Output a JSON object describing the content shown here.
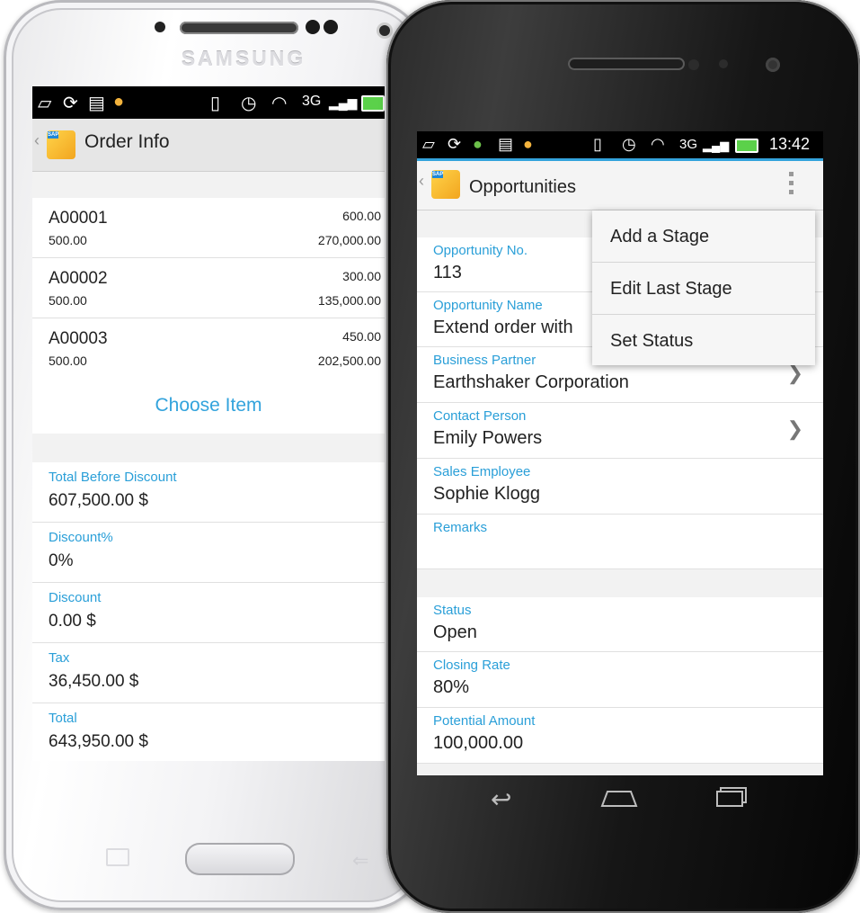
{
  "left_phone": {
    "brand": "SAMSUNG",
    "status_bar": {
      "icons": [
        "image-icon",
        "sync-icon",
        "keyboard-icon",
        "burger-icon",
        "vibrate-icon",
        "alarm-icon",
        "wifi-icon",
        "3g-icon",
        "signal-icon",
        "battery-icon"
      ]
    },
    "action_bar": {
      "back": "‹",
      "title": "Order Info"
    },
    "items": [
      {
        "code": "A00001",
        "qty": "500.00",
        "price": "600.00",
        "total": "270,000.00"
      },
      {
        "code": "A00002",
        "qty": "500.00",
        "price": "300.00",
        "total": "135,000.00"
      },
      {
        "code": "A00003",
        "qty": "500.00",
        "price": "450.00",
        "total": "202,500.00"
      }
    ],
    "choose_item": "Choose Item",
    "fields": [
      {
        "label": "Total Before Discount",
        "value": "607,500.00 $"
      },
      {
        "label": "Discount%",
        "value": "0%"
      },
      {
        "label": "Discount",
        "value": "0.00 $"
      },
      {
        "label": "Tax",
        "value": "36,450.00 $"
      },
      {
        "label": "Total",
        "value": "643,950.00 $"
      }
    ]
  },
  "right_phone": {
    "status_bar": {
      "time": "13:42"
    },
    "action_bar": {
      "back": "‹",
      "title": "Opportunities"
    },
    "fields": [
      {
        "label": "Opportunity No.",
        "value": "113"
      },
      {
        "label": "Opportunity Name",
        "value": "Extend order with"
      },
      {
        "label": "Business Partner",
        "value": "Earthshaker Corporation"
      },
      {
        "label": "Contact Person",
        "value": "Emily Powers"
      },
      {
        "label": "Sales Employee",
        "value": "Sophie Klogg"
      },
      {
        "label": "Remarks",
        "value": ""
      },
      {
        "label": "Status",
        "value": "Open"
      },
      {
        "label": "Closing Rate",
        "value": "80%"
      },
      {
        "label": "Potential Amount",
        "value": "100,000.00"
      }
    ],
    "overflow_menu": [
      "Add a Stage",
      "Edit Last Stage",
      "Set Status"
    ],
    "app_icon_tag": "SAP"
  }
}
